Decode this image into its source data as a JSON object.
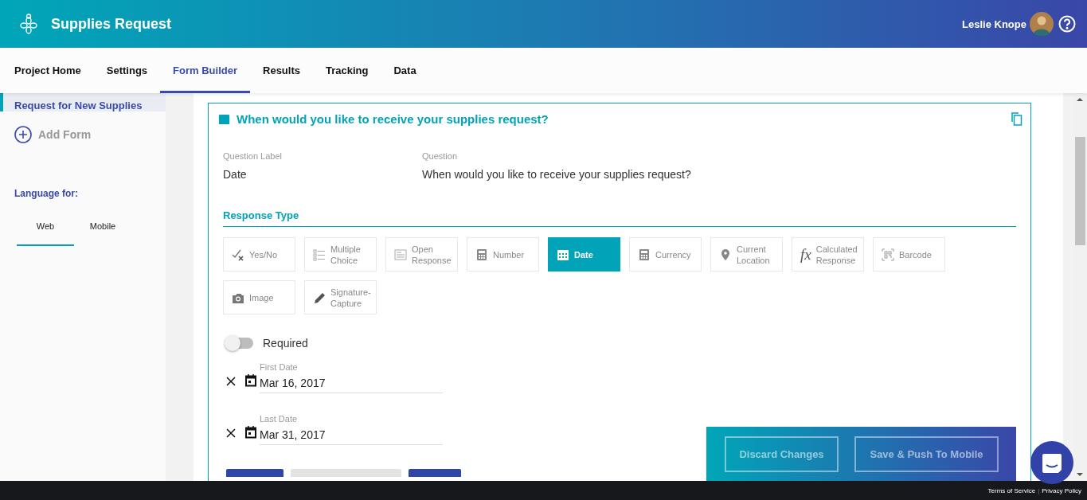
{
  "header": {
    "title": "Supplies Request",
    "user_name": "Leslie Knope"
  },
  "nav_tabs": [
    {
      "label": "Project Home",
      "selected": false
    },
    {
      "label": "Settings",
      "selected": false
    },
    {
      "label": "Form Builder",
      "selected": true
    },
    {
      "label": "Results",
      "selected": false
    },
    {
      "label": "Tracking",
      "selected": false
    },
    {
      "label": "Data",
      "selected": false
    }
  ],
  "sidebar": {
    "form_item": {
      "label": "Request for New Supplies",
      "selected": true
    },
    "add_form": "Add Form",
    "language_heading": "Language for:",
    "language_tabs": [
      {
        "label": "Web",
        "selected": true
      },
      {
        "label": "Mobile",
        "selected": false
      }
    ]
  },
  "question_card": {
    "title": "When would you like to receive your supplies request?",
    "question_label_heading": "Question Label",
    "question_label": "Date",
    "question_heading": "Question",
    "question": "When would you like to receive your supplies request?",
    "response_type_heading": "Response Type",
    "response_types": [
      {
        "kind": "yesno",
        "label": "Yes/No",
        "selected": false
      },
      {
        "kind": "multiple",
        "label": "Multiple Choice",
        "selected": false
      },
      {
        "kind": "open",
        "label": "Open Response",
        "selected": false
      },
      {
        "kind": "number",
        "label": "Number",
        "selected": false
      },
      {
        "kind": "date",
        "label": "Date",
        "selected": true
      },
      {
        "kind": "currency",
        "label": "Currency",
        "selected": false
      },
      {
        "kind": "location",
        "label": "Current Location",
        "selected": false
      },
      {
        "kind": "calculated",
        "icon": "fx",
        "label": "Calculated Response",
        "selected": false
      },
      {
        "kind": "barcode",
        "label": "Barcode",
        "selected": false
      },
      {
        "kind": "image",
        "label": "Image",
        "selected": false
      },
      {
        "kind": "signature",
        "label": "Signature-Capture",
        "selected": false
      }
    ],
    "required": {
      "label": "Required",
      "on": false
    },
    "date_fields": [
      {
        "label": "First Date",
        "value": "Mar 16, 2017"
      },
      {
        "label": "Last Date",
        "value": "Mar 31, 2017"
      }
    ]
  },
  "action_bar": {
    "buttons": [
      "Discard Changes",
      "Save & Push To Mobile"
    ]
  },
  "footer": {
    "links": [
      "Terms of Service",
      "Privacy Policy"
    ],
    "separator": "|"
  }
}
